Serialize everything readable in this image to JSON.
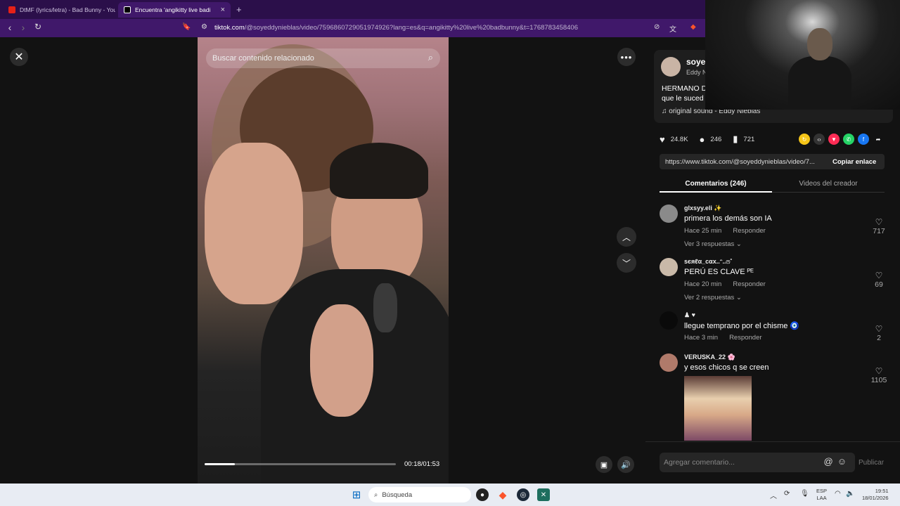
{
  "browser": {
    "tabs": [
      {
        "label": "DtMF (lyrics/letra) - Bad Bunny - You"
      },
      {
        "label": "Encuentra 'angikitty live badi"
      }
    ],
    "new_tab": "+",
    "close_tab": "×",
    "url_domain": "tiktok.com",
    "url_path": "/@soyeddynieblas/video/7596860729051974926?lang=es&q=angikitty%20live%20badbunny&t=1768783458406"
  },
  "video": {
    "search_placeholder": "Buscar contenido relacionado",
    "time": "00:18/01:53",
    "progress": 0.159
  },
  "author": {
    "name": "soye",
    "sub": "Eddy N",
    "desc_line1": "HERMANO D",
    "desc_line2": "que le suced",
    "sound": "original sound - Eddy Nieblas"
  },
  "stats": {
    "likes": "24.8K",
    "comments": "246",
    "saves": "721"
  },
  "link": {
    "url": "https://www.tiktok.com/@soyeddynieblas/video/7...",
    "copy_label": "Copiar enlace"
  },
  "panel_tabs": {
    "comments": "Comentarios (246)",
    "creator": "Videos del creador"
  },
  "comments": [
    {
      "user": "glxsyy.eli ✨",
      "text": "primera los demás son IA",
      "time": "Hace 25 min",
      "reply": "Responder",
      "replies": "Ver 3 respuestas ⌄",
      "likes": "717"
    },
    {
      "user": "ѕєяℓα_cαx..ᵔ..ෆ˚",
      "text": "PERÚ ES CLAVE ᴾᴱ",
      "time": "Hace 20 min",
      "reply": "Responder",
      "replies": "Ver 2 respuestas ⌄",
      "likes": "69"
    },
    {
      "user": "♟ ♥",
      "text": "llegue temprano por el chisme 🧿",
      "time": "Hace 3 min",
      "reply": "Responder",
      "replies": "",
      "likes": "2"
    },
    {
      "user": "VERUSKA_22 🌸",
      "text": "y esos chicos q se creen",
      "time": "",
      "reply": "",
      "replies": "",
      "likes": "1105"
    }
  ],
  "comment_input": {
    "placeholder": "Agregar comentario...",
    "publish": "Publicar"
  },
  "taskbar": {
    "search": "Búsqueda",
    "lang_line1": "ESP",
    "lang_line2": "LAA",
    "time": "19:51",
    "date": "18/01/2026"
  },
  "colors": {
    "browser_bg": "#2b0f4a",
    "addr_bg": "#40186a",
    "page_bg": "#121212",
    "taskbar_bg": "#e8ecf3"
  }
}
